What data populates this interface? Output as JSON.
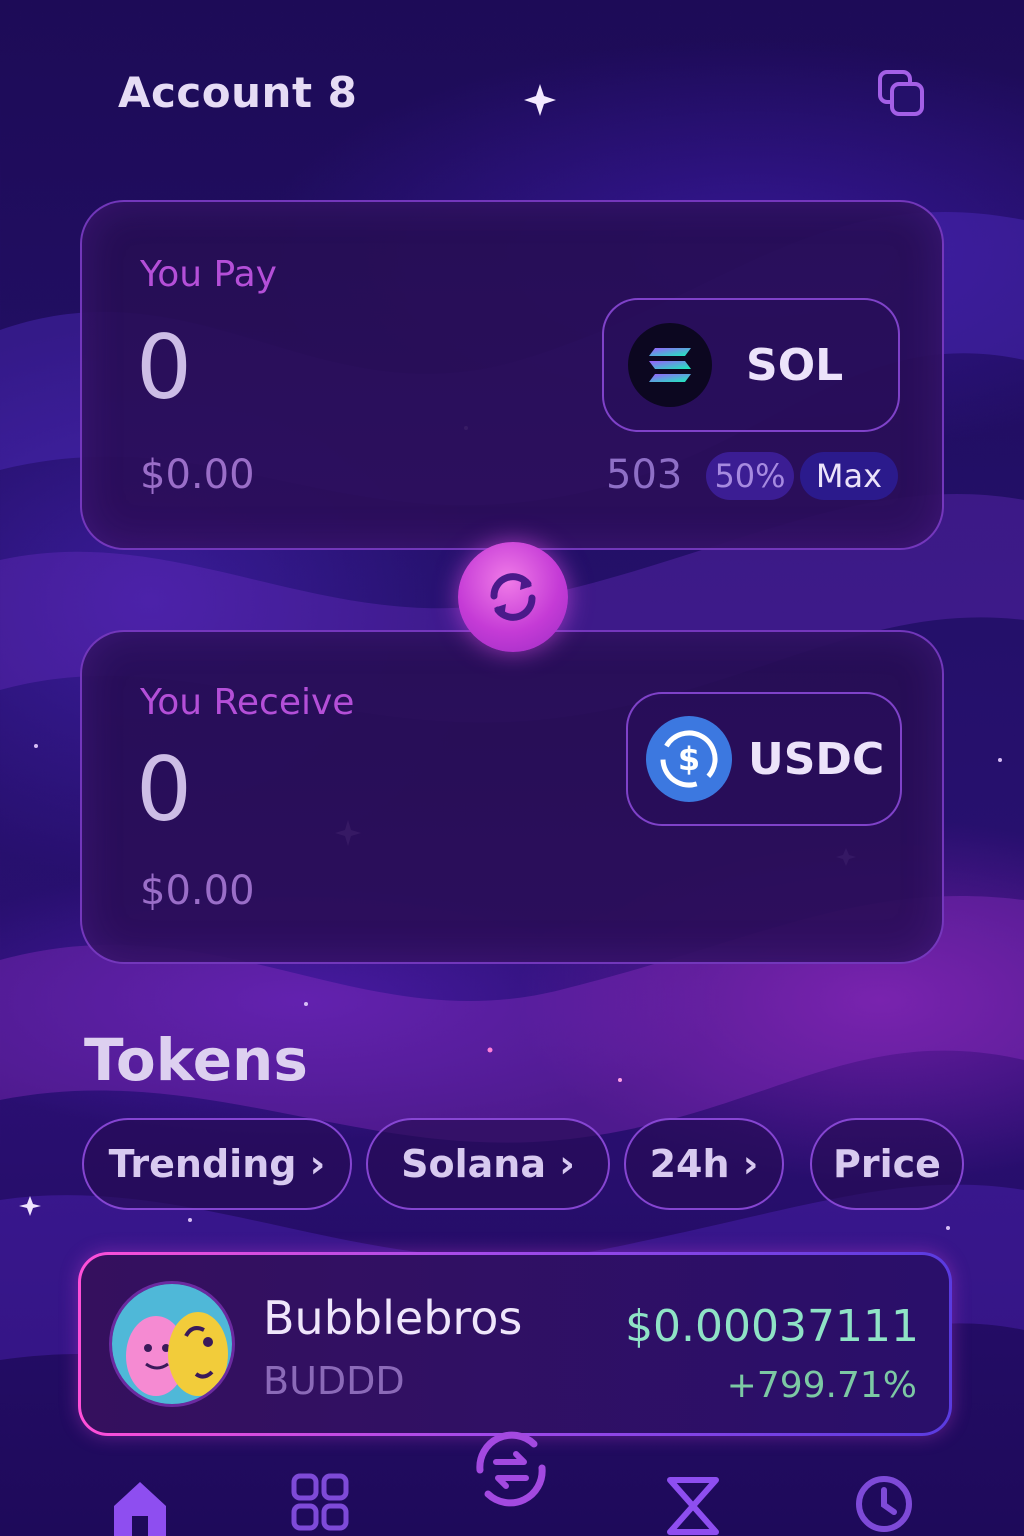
{
  "header": {
    "title": "Account 8",
    "copy_icon": "copy-icon"
  },
  "pay": {
    "label": "You Pay",
    "amount": "0",
    "usd": "$0.00",
    "token": "SOL",
    "balance": "503",
    "half_label": "50%",
    "max_label": "Max"
  },
  "receive": {
    "label": "You Receive",
    "amount": "0",
    "usd": "$0.00",
    "token": "USDC"
  },
  "swap_icon": "swap-arrows-icon",
  "tokens": {
    "title": "Tokens",
    "filters": [
      {
        "label": "Trending ›"
      },
      {
        "label": "Solana ›"
      },
      {
        "label": "24h ›"
      },
      {
        "label": "Price"
      }
    ],
    "items": [
      {
        "name": "Bubblebros",
        "ticker": "BUDDD",
        "price": "$0.00037111",
        "change": "+799.71%"
      }
    ]
  },
  "nav": {
    "items": [
      "home-icon",
      "grid-icon",
      "swap-icon",
      "hourglass-icon",
      "clock-icon"
    ],
    "active": "home-icon"
  },
  "colors": {
    "accent_pink": "#d94fe0",
    "accent_purple": "#8a4be8",
    "positive": "#7cc9a4"
  }
}
